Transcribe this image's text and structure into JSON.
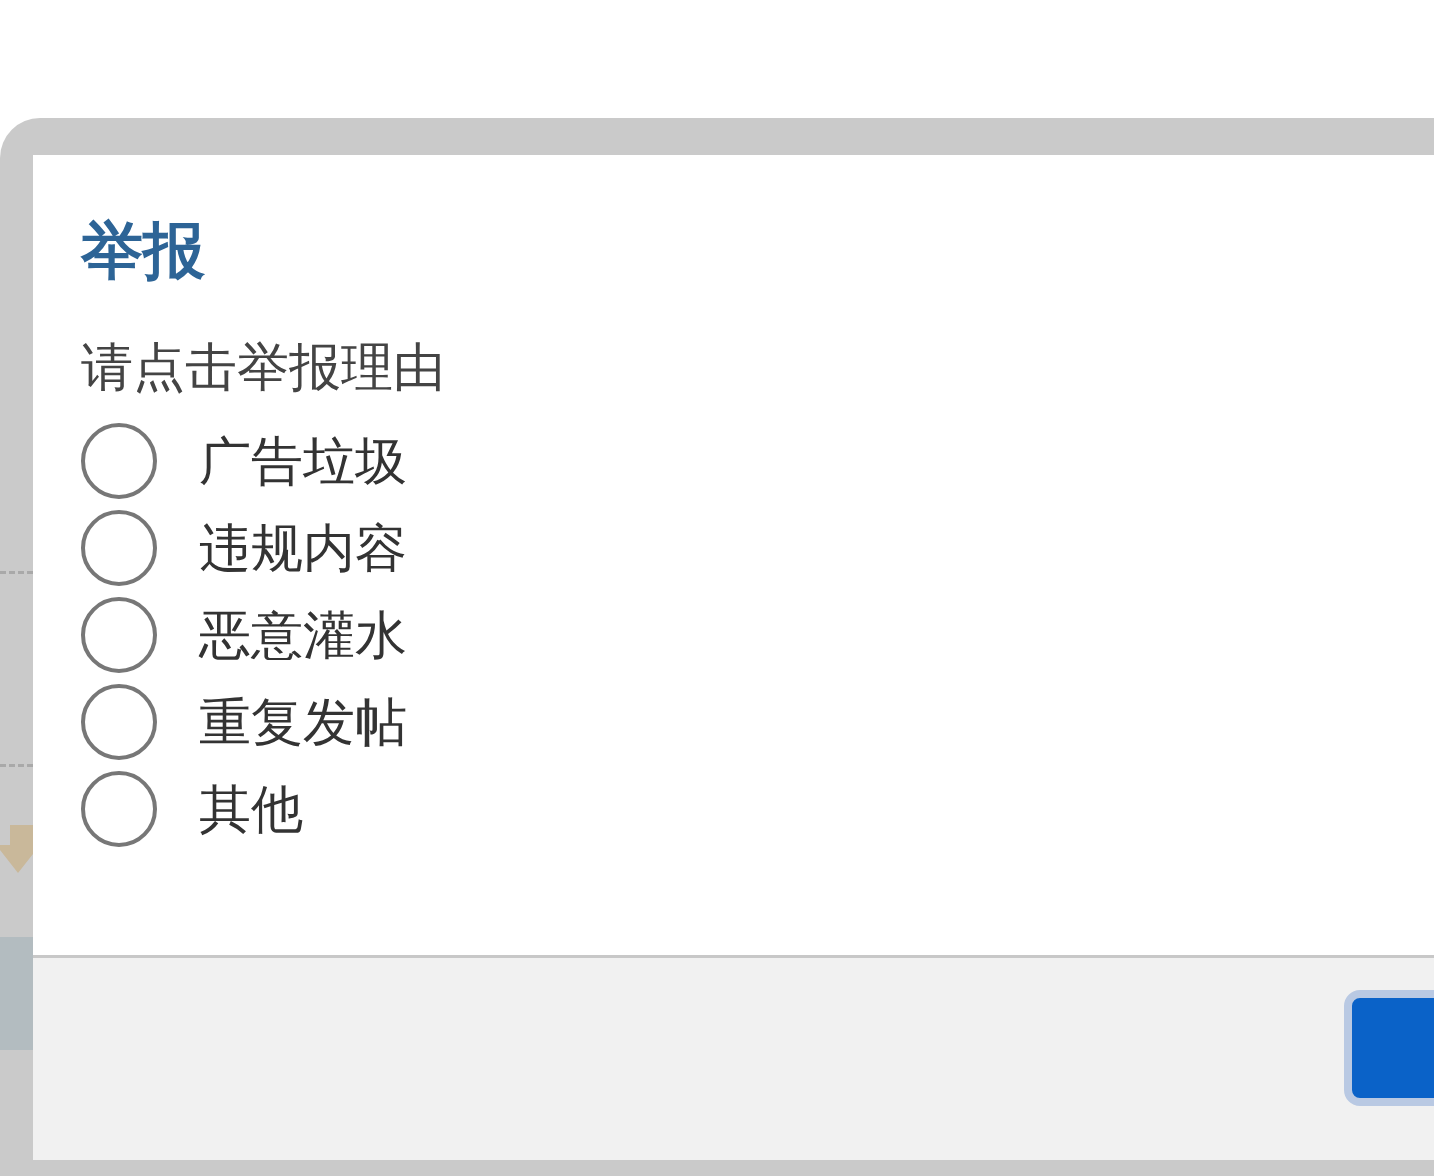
{
  "dialog": {
    "title": "举报",
    "prompt": "请点击举报理由",
    "options": [
      {
        "label": "广告垃圾",
        "selected": false
      },
      {
        "label": "违规内容",
        "selected": false
      },
      {
        "label": "恶意灌水",
        "selected": false
      },
      {
        "label": "重复发帖",
        "selected": false
      },
      {
        "label": "其他",
        "selected": false
      }
    ]
  }
}
